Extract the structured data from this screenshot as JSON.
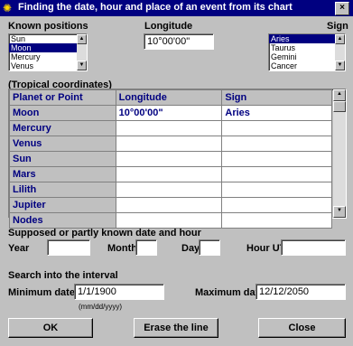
{
  "window": {
    "title": "Finding the date, hour and place of an event from its chart",
    "close_glyph": "×"
  },
  "known_positions": {
    "label": "Known positions",
    "items": [
      "Sun",
      "Moon",
      "Mercury",
      "Venus"
    ],
    "selected": "Moon"
  },
  "longitude": {
    "label": "Longitude",
    "value": "10°00'00\""
  },
  "sign": {
    "label": "Sign",
    "items": [
      "Aries",
      "Taurus",
      "Gemini",
      "Cancer"
    ],
    "selected": "Aries"
  },
  "table": {
    "caption": "(Tropical coordinates)",
    "headers": [
      "Planet or Point",
      "Longitude",
      "Sign"
    ],
    "rows": [
      [
        "Moon",
        "10°00'00\"",
        "Aries"
      ],
      [
        "Mercury",
        "",
        ""
      ],
      [
        "Venus",
        "",
        ""
      ],
      [
        "Sun",
        "",
        ""
      ],
      [
        "Mars",
        "",
        ""
      ],
      [
        "Lilith",
        "",
        ""
      ],
      [
        "Jupiter",
        "",
        ""
      ],
      [
        "Nodes",
        "",
        ""
      ]
    ]
  },
  "date_hour": {
    "label": "Supposed or partly known date and hour",
    "year_label": "Year",
    "year_value": "",
    "month_label": "Month",
    "month_value": "",
    "day_label": "Day",
    "day_value": "",
    "hour_label": "Hour UT",
    "hour_value": ""
  },
  "interval": {
    "label": "Search into the interval",
    "min_label": "Minimum date",
    "min_value": "1/1/1900",
    "max_label": "Maximum date",
    "max_value": "12/12/2050",
    "format_hint": "(mm/dd/yyyy)"
  },
  "buttons": {
    "ok": "OK",
    "erase": "Erase the line",
    "close": "Close"
  },
  "colors": {
    "titlebar": "#000080",
    "accent_text": "#000080",
    "face": "#c0c0c0"
  }
}
